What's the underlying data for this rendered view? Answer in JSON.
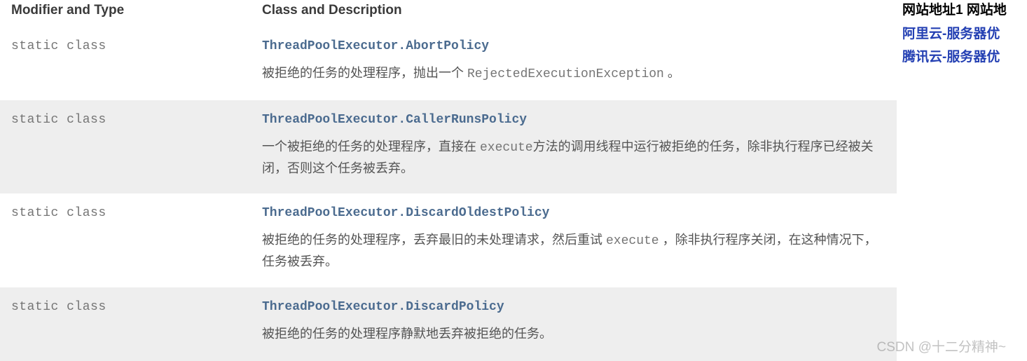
{
  "headers": {
    "col1": "Modifier and Type",
    "col2": "Class and Description"
  },
  "rows": [
    {
      "modifier": "static class",
      "class_name": "ThreadPoolExecutor.AbortPolicy",
      "description_pre": "被拒绝的任务的处理程序，抛出一个 ",
      "description_mono": "RejectedExecutionException",
      "description_post": " 。"
    },
    {
      "modifier": "static class",
      "class_name": "ThreadPoolExecutor.CallerRunsPolicy",
      "description_pre": "一个被拒绝的任务的处理程序，直接在 ",
      "description_mono": "execute",
      "description_post": "方法的调用线程中运行被拒绝的任务，除非执行程序已经被关闭，否则这个任务被丢弃。"
    },
    {
      "modifier": "static class",
      "class_name": "ThreadPoolExecutor.DiscardOldestPolicy",
      "description_pre": "被拒绝的任务的处理程序，丢弃最旧的未处理请求，然后重试 ",
      "description_mono": "execute",
      "description_post": " ，除非执行程序关闭，在这种情况下，任务被丢弃。"
    },
    {
      "modifier": "static class",
      "class_name": "ThreadPoolExecutor.DiscardPolicy",
      "description_pre": "被拒绝的任务的处理程序静默地丢弃被拒绝的任务。",
      "description_mono": "",
      "description_post": ""
    }
  ],
  "side": {
    "top": "网站地址1 网站地",
    "link1": "阿里云-服务器优",
    "link2": "腾讯云-服务器优"
  },
  "watermark": "CSDN @十二分精神~"
}
